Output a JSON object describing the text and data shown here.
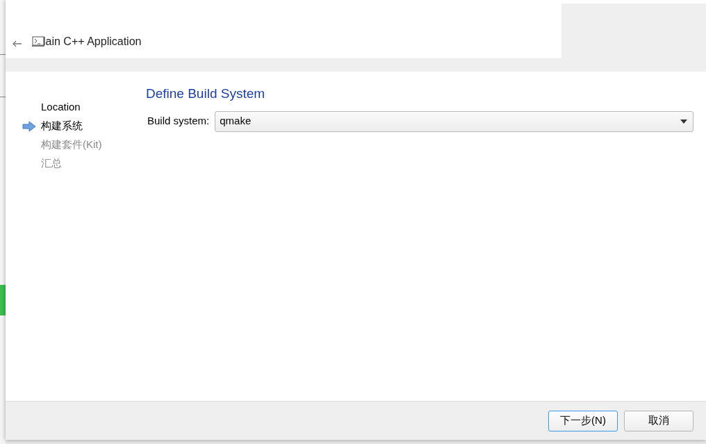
{
  "window": {
    "title": "lain C++ Application"
  },
  "steps": [
    {
      "label": "Location",
      "selected": false,
      "disabled": false
    },
    {
      "label": "构建系统",
      "selected": true,
      "disabled": false
    },
    {
      "label": "构建套件(Kit)",
      "selected": false,
      "disabled": true
    },
    {
      "label": "汇总",
      "selected": false,
      "disabled": true
    }
  ],
  "page": {
    "heading": "Define Build System",
    "field_label": "Build system:",
    "build_system": {
      "value": "qmake"
    }
  },
  "buttons": [
    {
      "label": "下一步(N)",
      "default": true
    },
    {
      "label": "取消",
      "default": false
    }
  ]
}
